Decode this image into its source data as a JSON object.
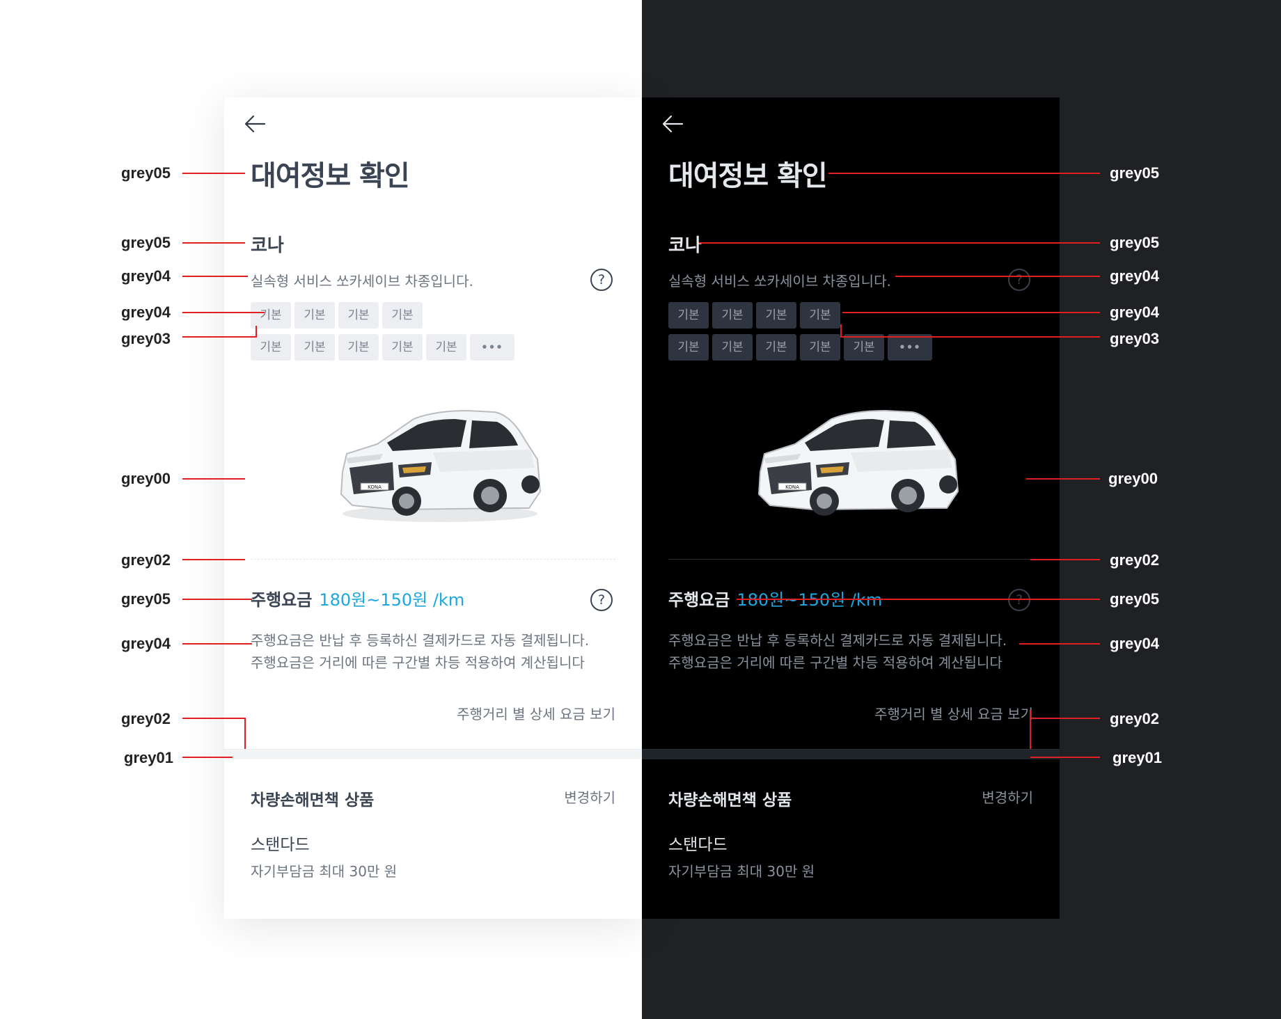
{
  "screen": {
    "title": "대여정보 확인",
    "car_name": "코나",
    "car_description": "실속형 서비스 쏘카세이브 차종입니다.",
    "help_symbol": "?",
    "tags_row1": [
      "기본",
      "기본",
      "기본",
      "기본"
    ],
    "tags_row2": [
      "기본",
      "기본",
      "기본",
      "기본",
      "기본"
    ],
    "more_label": "•••",
    "fee_label": "주행요금",
    "fee_value": "180원~150원 /km",
    "fee_desc_line1": "주행요금은 반납 후 등록하신 결제카드로 자동 결제됩니다.",
    "fee_desc_line2": "주행요금은 거리에 따른 구간별 차등 적용하여 계산됩니다",
    "fee_link": "주행거리 별 상세 요금 보기",
    "insurance_title": "차량손해면책 상품",
    "insurance_change": "변경하기",
    "insurance_plan": "스탠다드",
    "insurance_detail": "자기부담금 최대 30만 원",
    "car_plate_text": "KONA"
  },
  "annotations": {
    "left": [
      "grey05",
      "grey05",
      "grey04",
      "grey04",
      "grey03",
      "grey00",
      "grey02",
      "grey05",
      "grey04",
      "grey02",
      "grey01"
    ],
    "right": [
      "grey05",
      "grey05",
      "grey04",
      "grey04",
      "grey03",
      "grey00",
      "grey02",
      "grey05",
      "grey04",
      "grey02",
      "grey01"
    ]
  },
  "colors": {
    "accent": "#1da7e0",
    "annotation_line": "#e02020",
    "light_text_primary": "#3a4452",
    "light_text_secondary": "#6b7480",
    "dark_text_primary": "#e4e7ec",
    "dark_text_secondary": "#8a929e",
    "dark_backdrop": "#1f2125"
  },
  "icons": [
    "back-arrow-icon",
    "help-icon",
    "more-dots-icon",
    "car-image"
  ]
}
